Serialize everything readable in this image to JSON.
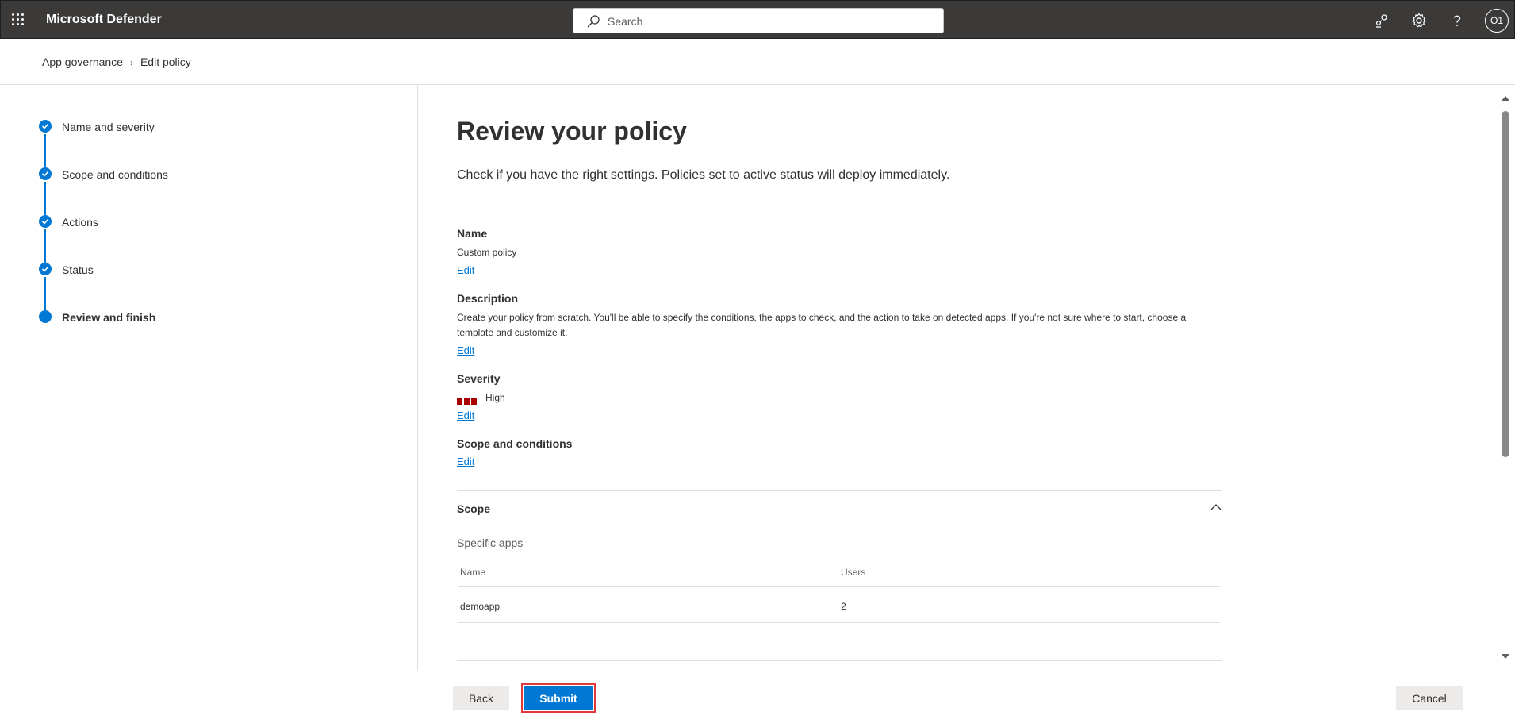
{
  "header": {
    "app_title": "Microsoft Defender",
    "search_placeholder": "Search",
    "avatar_initials": "O1"
  },
  "breadcrumb": {
    "items": [
      "App governance",
      "Edit policy"
    ]
  },
  "steps": [
    {
      "label": "Name and severity",
      "status": "done"
    },
    {
      "label": "Scope and conditions",
      "status": "done"
    },
    {
      "label": "Actions",
      "status": "done"
    },
    {
      "label": "Status",
      "status": "done"
    },
    {
      "label": "Review and finish",
      "status": "current"
    }
  ],
  "review": {
    "title": "Review your policy",
    "subtitle": "Check if you have the right settings. Policies set to active status will deploy immediately.",
    "edit_label": "Edit",
    "name": {
      "heading": "Name",
      "value": "Custom policy"
    },
    "description": {
      "heading": "Description",
      "value_line1": "Create your policy from scratch. You'll be able to specify the conditions, the apps to check, and the action to take on detected apps. If you're not sure where to start, choose a",
      "value_line2": "template and customize it."
    },
    "severity": {
      "heading": "Severity",
      "value": "High",
      "color": "#a80000"
    },
    "scope_conditions": {
      "heading": "Scope and conditions"
    },
    "scope": {
      "heading": "Scope",
      "subheading": "Specific apps",
      "columns": [
        "Name",
        "Users"
      ],
      "rows": [
        {
          "name": "demoapp",
          "users": "2"
        }
      ]
    }
  },
  "footer": {
    "back_label": "Back",
    "submit_label": "Submit",
    "cancel_label": "Cancel"
  },
  "colors": {
    "accent": "#0078d4",
    "topbar": "#3b3a39",
    "highlight": "#e0393e"
  }
}
